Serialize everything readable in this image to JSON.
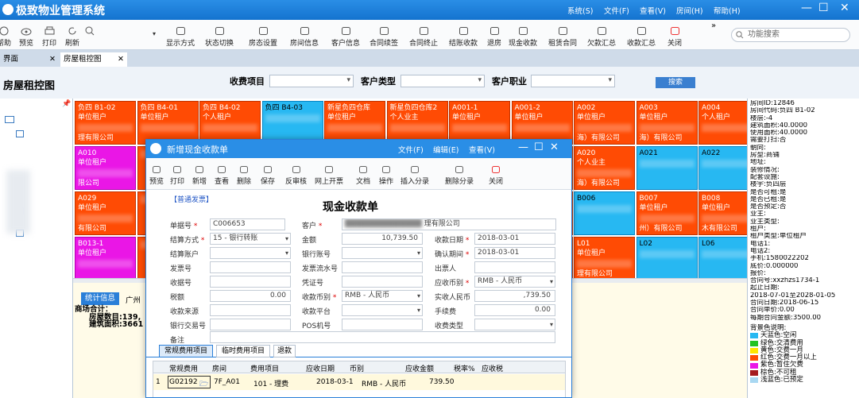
{
  "app": {
    "title": "极致物业管理系统",
    "menus": [
      "系统(S)",
      "文件(F)",
      "查看(V)",
      "房间(H)",
      "帮助(H)"
    ],
    "win_controls": [
      "—",
      "☐",
      "✕"
    ]
  },
  "toolbar": {
    "left_items": [
      "帮助",
      "预览",
      "打印",
      "刷新"
    ],
    "items": [
      "显示方式",
      "状态切换",
      "房态设置",
      "房间信息",
      "客户信息",
      "合同续签",
      "合同终止",
      "结账收款",
      "退房",
      "现金收款",
      "租赁合同",
      "欠款汇总",
      "收款汇总",
      "关闭"
    ],
    "more": "»",
    "search_placeholder": "功能搜索"
  },
  "tabs": [
    "界面",
    "房屋租控图"
  ],
  "filter": {
    "page_title": "房屋租控图",
    "labels": [
      "收费项目",
      "客户类型",
      "客户职业"
    ],
    "search_btn": "搜索"
  },
  "grid": {
    "rows": [
      [
        {
          "n": "负四 B1-02",
          "t": "单位租户",
          "c": "red",
          "x": "理有限公司"
        },
        {
          "n": "负四 B4-01",
          "t": "单位租户",
          "c": "red",
          "x": ""
        },
        {
          "n": "负四 B4-02",
          "t": "个人租户",
          "c": "red",
          "x": ""
        },
        {
          "n": "负四 B4-03",
          "t": "",
          "c": "blue",
          "x": ""
        },
        {
          "n": "新星负四仓库",
          "t": "单位租户",
          "c": "red",
          "x": ""
        },
        {
          "n": "新星负四仓库2",
          "t": "个人业主",
          "c": "red",
          "x": ""
        },
        {
          "n": "A001-1",
          "t": "单位租户",
          "c": "red",
          "x": ""
        },
        {
          "n": "A001-2",
          "t": "单位租户",
          "c": "red",
          "x": ""
        },
        {
          "n": "A002",
          "t": "单位租户",
          "c": "red",
          "x": "海）有限公司"
        },
        {
          "n": "A003",
          "t": "单位租户",
          "c": "red",
          "x": "海）有限公司"
        },
        {
          "n": "A004",
          "t": "个人租户",
          "c": "red",
          "x": ""
        }
      ],
      [
        {
          "n": "A010",
          "t": "单位租户",
          "c": "mag",
          "x": "限公司"
        },
        {
          "n": "",
          "t": "",
          "c": "red",
          "x": ""
        },
        {
          "n": "",
          "t": "",
          "c": "red",
          "x": ""
        },
        {
          "n": "",
          "t": "",
          "c": "red",
          "x": ""
        },
        {
          "n": "",
          "t": "",
          "c": "red",
          "x": ""
        },
        {
          "n": "",
          "t": "",
          "c": "red",
          "x": ""
        },
        {
          "n": "",
          "t": "",
          "c": "red",
          "x": ""
        },
        {
          "n": "",
          "t": "",
          "c": "red",
          "x": ""
        },
        {
          "n": "A020",
          "t": "个人业主",
          "c": "red",
          "x": "海）有限公司"
        },
        {
          "n": "A021",
          "t": "",
          "c": "blue",
          "x": ""
        },
        {
          "n": "A022",
          "t": "",
          "c": "blue",
          "x": ""
        }
      ],
      [
        {
          "n": "A029",
          "t": "单位租户",
          "c": "red",
          "x": "有限公司"
        },
        {
          "n": "",
          "t": "",
          "c": "red",
          "x": ""
        },
        {
          "n": "",
          "t": "",
          "c": "red",
          "x": ""
        },
        {
          "n": "",
          "t": "",
          "c": "red",
          "x": ""
        },
        {
          "n": "",
          "t": "",
          "c": "red",
          "x": ""
        },
        {
          "n": "",
          "t": "",
          "c": "red",
          "x": ""
        },
        {
          "n": "",
          "t": "",
          "c": "red",
          "x": ""
        },
        {
          "n": "",
          "t": "",
          "c": "red",
          "x": ""
        },
        {
          "n": "B006",
          "t": "",
          "c": "blue",
          "x": ""
        },
        {
          "n": "B007",
          "t": "单位租户",
          "c": "red",
          "x": "州）有限公司"
        },
        {
          "n": "B008",
          "t": "单位租户",
          "c": "red",
          "x": "木有限公司"
        }
      ],
      [
        {
          "n": "B013-1",
          "t": "单位租户",
          "c": "mag",
          "x": ""
        },
        {
          "n": "",
          "t": "",
          "c": "red",
          "x": ""
        },
        {
          "n": "",
          "t": "",
          "c": "red",
          "x": ""
        },
        {
          "n": "",
          "t": "",
          "c": "red",
          "x": ""
        },
        {
          "n": "",
          "t": "",
          "c": "red",
          "x": ""
        },
        {
          "n": "",
          "t": "",
          "c": "red",
          "x": ""
        },
        {
          "n": "",
          "t": "",
          "c": "red",
          "x": ""
        },
        {
          "n": "",
          "t": "",
          "c": "red",
          "x": ""
        },
        {
          "n": "L01",
          "t": "单位租户",
          "c": "red",
          "x": "理有限公司"
        },
        {
          "n": "L02",
          "t": "",
          "c": "blue",
          "x": ""
        },
        {
          "n": "L06",
          "t": "",
          "c": "blue",
          "x": ""
        }
      ]
    ]
  },
  "bottom": {
    "tabs": [
      "统计信息",
      "广州"
    ],
    "stats": [
      "商场合计：",
      "房屋数目:139,",
      "建筑面积:3661"
    ]
  },
  "room_info": [
    "房间ID:12846",
    "房间代码:负四 B1-02",
    "楼层:-4",
    "建筑面积:40.0000",
    "使用面积:40.0000",
    "需要打扫:否",
    "朝向:",
    "房型:商铺",
    "地址:",
    "装修情况:",
    "配套设施:",
    "楼宇:负四层",
    "是否可租:是",
    "是否已租:是",
    "是否预定:否",
    "业主:",
    "业主类型:",
    "租户:",
    "租户类型:单位租户",
    "电话1:",
    "电话2:",
    "手机:1580022202",
    "底价:0.000000",
    "报价:",
    "合同号:xxzhzs1734-1",
    "起止日期:",
    "2018-07-01至2028-01-05",
    "合同日期:2018-06-15",
    "合同单价:0.00",
    "每期合同金额:3500.00"
  ],
  "legend": {
    "title": "背景色说明:",
    "items": [
      {
        "label": "天蓝色:空闲",
        "color": "#27b8f2"
      },
      {
        "label": "绿色:交清费用",
        "color": "#22c322"
      },
      {
        "label": "黄色:交费一月",
        "color": "#ffe600"
      },
      {
        "label": "红色:交费一月以上",
        "color": "#ff4b04"
      },
      {
        "label": "紫色:暂住欠费",
        "color": "#ea16e6"
      },
      {
        "label": "棕色:不可租",
        "color": "#a51c20"
      },
      {
        "label": "浅蓝色:已预定",
        "color": "#a9d8f2"
      }
    ]
  },
  "dialog": {
    "title": "新增现金收款单",
    "menus": [
      "文件(F)",
      "编辑(E)",
      "查看(V)"
    ],
    "toolbar": [
      "预览",
      "打印",
      "新增",
      "查看",
      "删除",
      "保存",
      "反审核",
      "网上开票",
      "文档",
      "操作",
      "插入分录",
      "删除分录",
      "关闭"
    ],
    "type_link": "【普通发票】",
    "form_title": "现金收款单",
    "fields": {
      "bill_no_l": "单据号",
      "bill_no": "C006653",
      "customer_l": "客户",
      "customer": "理有限公司",
      "settle_l": "结算方式",
      "settle": "15 - 银行转账",
      "amount_l": "金额",
      "amount": "10,739.50",
      "recv_date_l": "收款日期",
      "recv_date": "2018-03-01",
      "settle_acc_l": "结算账户",
      "bank_acc_l": "银行账号",
      "confirm_l": "确认期间",
      "confirm": "2018-03-01",
      "invoice_no_l": "发票号",
      "invoice_flow_l": "发票流水号",
      "drawer_l": "出票人",
      "receipt_l": "收据号",
      "voucher_l": "凭证号",
      "cur_l": "应收币别",
      "cur": "RMB - 人民币",
      "tax_l": "税额",
      "tax": "0.00",
      "recv_cur_l": "收款币别",
      "recv_cur": "RMB - 人民币",
      "actual_l": "实收人民币",
      "actual": ",739.50",
      "source_l": "收款来源",
      "platform_l": "收款平台",
      "fee_l": "手续费",
      "fee": "0.00",
      "bank_tx_l": "银行交易号",
      "pos_l": "POS机号",
      "recv_type_l": "收费类型",
      "memo_l": "备注"
    },
    "subtabs": [
      "常规费用项目",
      "临时费用项目",
      "退款"
    ],
    "table": {
      "headers": [
        "常规费用",
        "房间",
        "费用项目",
        "应收日期",
        "币别",
        "应收金额",
        "税率%",
        "应收税"
      ],
      "row": {
        "idx": "1",
        "code": "G02192",
        "room": "7F_A01",
        "item": "101 - 理费",
        "date": "2018-03-1",
        "cur": "RMB - 人民币",
        "amt": "739.50"
      }
    }
  }
}
